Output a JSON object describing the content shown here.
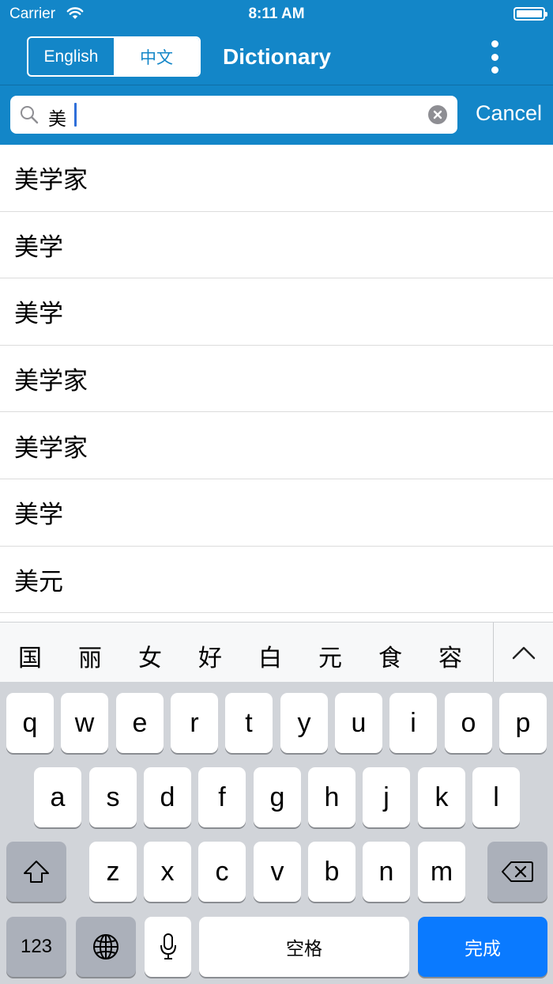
{
  "status_bar": {
    "carrier": "Carrier",
    "time": "8:11 AM"
  },
  "navbar": {
    "segments": {
      "english": "English",
      "chinese": "中文",
      "selected": "中文"
    },
    "title": "Dictionary"
  },
  "search": {
    "query": "美",
    "cancel_label": "Cancel"
  },
  "results": [
    "美学家",
    "美学",
    "美学",
    "美学家",
    "美学家",
    "美学",
    "美元"
  ],
  "candidates": [
    "国",
    "丽",
    "女",
    "好",
    "白",
    "元",
    "食",
    "容"
  ],
  "keyboard": {
    "row1": [
      "q",
      "w",
      "e",
      "r",
      "t",
      "y",
      "u",
      "i",
      "o",
      "p"
    ],
    "row2": [
      "a",
      "s",
      "d",
      "f",
      "g",
      "h",
      "j",
      "k",
      "l"
    ],
    "row3": [
      "z",
      "x",
      "c",
      "v",
      "b",
      "n",
      "m"
    ],
    "numbers_label": "123",
    "space_label": "空格",
    "done_label": "完成"
  },
  "colors": {
    "header": "#1386c8",
    "done_key": "#0a7aff",
    "keyboard_bg": "#d1d4d9"
  }
}
